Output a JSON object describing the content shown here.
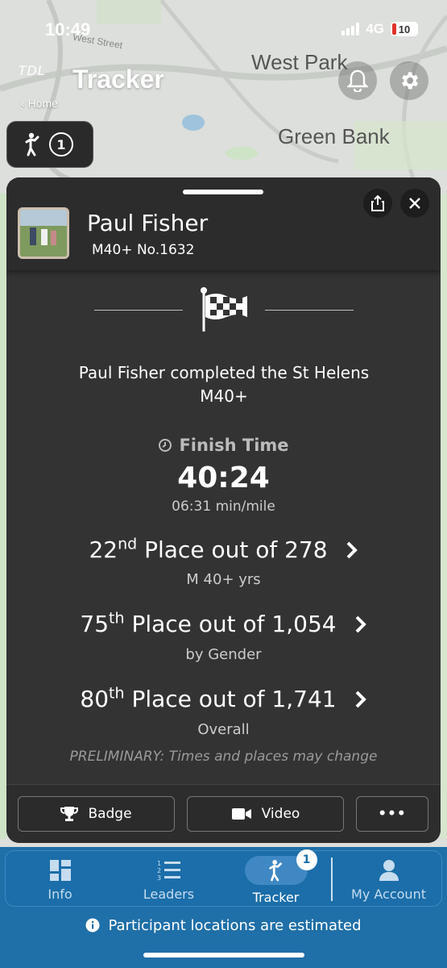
{
  "status_bar": {
    "time": "10:49",
    "network": "4G",
    "battery": "10"
  },
  "header": {
    "logo": "TDL",
    "title": "Tracker",
    "back_label": "Home"
  },
  "map": {
    "labels": {
      "west_park": "West Park",
      "green_bank": "Green Bank",
      "west_street": "West Street"
    }
  },
  "tracker_chip": {
    "count": "1"
  },
  "participant": {
    "name": "Paul Fisher",
    "category_number": "M40+ No.1632"
  },
  "result": {
    "completed_text": "Paul Fisher completed the St Helens M40+",
    "finish_label": "Finish Time",
    "finish_time": "40:24",
    "pace": "06:31 min/mile",
    "places": [
      {
        "rank": "22",
        "suffix": "nd",
        "out_of": "Place out of 278",
        "sub": "M 40+ yrs"
      },
      {
        "rank": "75",
        "suffix": "th",
        "out_of": "Place out of 1,054",
        "sub": "by Gender"
      },
      {
        "rank": "80",
        "suffix": "th",
        "out_of": "Place out of 1,741",
        "sub": "Overall"
      }
    ],
    "preliminary_note": "PRELIMINARY: Times and places may change"
  },
  "actions": {
    "badge": "Badge",
    "video": "Video",
    "more": "•••"
  },
  "nav": {
    "tabs": [
      {
        "label": "Info",
        "icon": "dashboard-icon"
      },
      {
        "label": "Leaders",
        "icon": "ordered-list-icon"
      },
      {
        "label": "Tracker",
        "icon": "runner-icon",
        "badge": "1"
      },
      {
        "label": "My Account",
        "icon": "person-icon"
      }
    ]
  },
  "notice": "Participant locations are estimated",
  "colors": {
    "card": "#333333",
    "nav": "#1b6ea9",
    "accent_red": "#e0332c"
  }
}
